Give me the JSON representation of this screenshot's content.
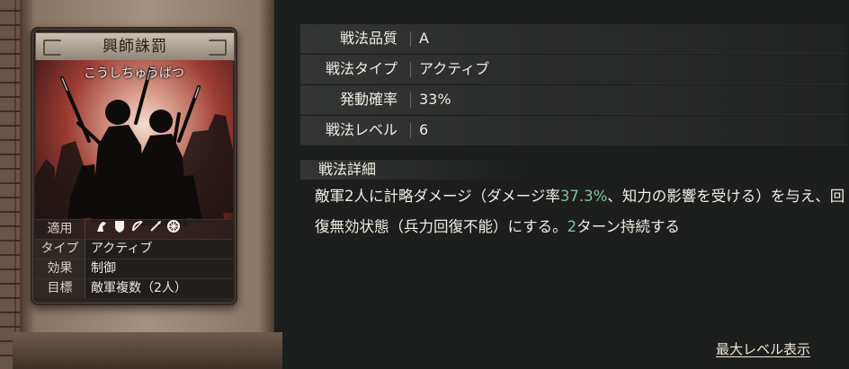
{
  "card": {
    "name": "興師誅罰",
    "reading": "こうしちゅうばつ",
    "props": [
      {
        "key": "適用",
        "icons": [
          "horse-icon",
          "shield-icon",
          "bow-icon",
          "spear-icon",
          "wheel-icon"
        ]
      },
      {
        "key": "タイプ",
        "value": "アクティブ"
      },
      {
        "key": "効果",
        "value": "制御"
      },
      {
        "key": "目標",
        "value": "敵軍複数（2人）"
      }
    ]
  },
  "info": {
    "rows": [
      {
        "label": "戦法品質",
        "value": "A"
      },
      {
        "label": "戦法タイプ",
        "value": "アクティブ"
      },
      {
        "label": "発動確率",
        "value": "33%"
      },
      {
        "label": "戦法レベル",
        "value": "6"
      }
    ],
    "detail_heading": "戦法詳細",
    "desc_parts": [
      "敵軍2人に計略ダメージ（ダメージ率",
      "37.3%",
      "、知力の影響を受ける）を与え、回復無効状態（兵力回復不能）にする。",
      "2",
      "ターン持続する"
    ],
    "highlight_color": "#7fc39a",
    "max_level_link": "最大レベル表示"
  }
}
